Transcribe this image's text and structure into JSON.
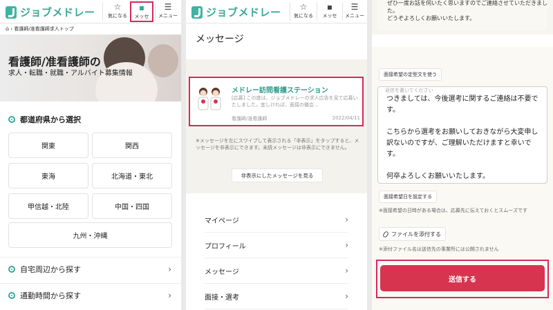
{
  "header": {
    "logo": "ジョブメドレー",
    "favorites_label": "気になる",
    "messages_label": "メッセ",
    "messages_label_p2": "メッセ",
    "menu_label": "メニュー"
  },
  "panel1": {
    "breadcrumb": "看護師/准看護師求人トップ",
    "hero_title": "看護師/准看護師の",
    "hero_subtitle": "求人・転職・就職・アルバイト募集情報",
    "section_prefecture": "都道府県から選択",
    "regions": [
      "関東",
      "関西",
      "東海",
      "北海道・東北",
      "甲信越・北陸",
      "中国・四国",
      "九州・沖縄"
    ],
    "links": [
      "自宅周辺から探す",
      "通勤時間から探す"
    ]
  },
  "panel2": {
    "title": "メッセージ",
    "message": {
      "sender": "メドレー訪問看護ステーション",
      "preview": "[応募] この度は、ジョブメドレーの求人広告を見て応募いたしました。宜しければ、面接の機会…",
      "job": "看護師/准看護師",
      "date": "2022/04/11"
    },
    "note": "※メッセージを左にスワイプして表示される「非表示」をタップすると、メッセージを非表示にできます。未読メッセージは非表示にできません。",
    "hidden_button": "非表示にしたメッセージを見る",
    "menu": [
      "マイページ",
      "プロフィール",
      "メッセージ",
      "面接・選考"
    ]
  },
  "panel3": {
    "top_message": "ぜひ一度お話を伺いたく思いますのでご連絡させていただきました。\nどうぞよろしくお願いいたします。",
    "template_button": "面接希望の定型文を使う",
    "textarea_placeholder": "返信を書いてください",
    "textarea_value": "つきましては、今後選考に関するご連絡は不要です。\n\nこちらから選考をお願いしておきながら大変申し訳ないのですが、ご理解いただけますと幸いです。\n\n何卒よろしくお願いいたします。",
    "date_button": "面接希望日を設定する",
    "date_note": "※面接希望の日時がある場合は、応募先に伝えておくとスムーズです",
    "attach_button": "ファイルを添付する",
    "attach_note": "※添付ファイル名は送信先の事業所には公開されません",
    "send_button": "送信する"
  },
  "colors": {
    "brand": "#3aa898",
    "highlight": "#d4285b",
    "send": "#d6344f"
  }
}
